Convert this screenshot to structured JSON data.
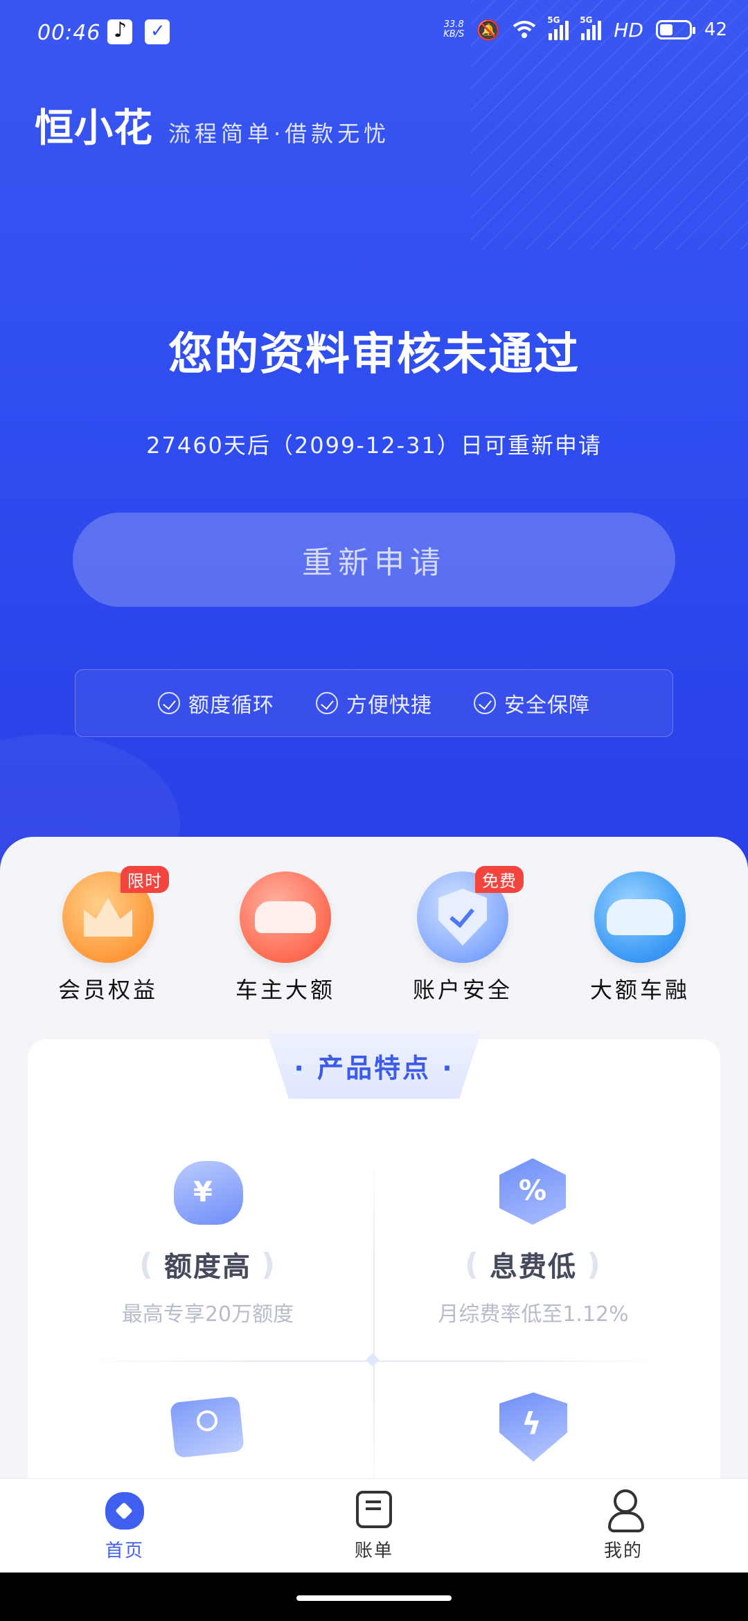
{
  "status_bar": {
    "time": "00:46",
    "net_speed_value": "33.8",
    "net_speed_unit": "KB/S",
    "signal1_label": "5G",
    "signal2_label": "5G",
    "hd_label": "HD",
    "battery": "42"
  },
  "header": {
    "brand": "恒小花",
    "slogan": "流程简单·借款无忧"
  },
  "status": {
    "title": "您的资料审核未通过",
    "subtitle": "27460天后（2099-12-31）日可重新申请",
    "button_label": "重新申请"
  },
  "features": [
    "额度循环",
    "方便快捷",
    "安全保障"
  ],
  "shortcuts": [
    {
      "label": "会员权益",
      "badge": "限时",
      "icon": "crown-icon"
    },
    {
      "label": "车主大额",
      "badge": "",
      "icon": "car-icon"
    },
    {
      "label": "账户安全",
      "badge": "免费",
      "icon": "shield-check-icon"
    },
    {
      "label": "大额车融",
      "badge": "",
      "icon": "car-loan-icon"
    }
  ],
  "product_card": {
    "title": "· 产品特点 ·",
    "items": [
      {
        "title": "额度高",
        "desc": "最高专享20万额度",
        "icon": "money-bag-icon",
        "glyph": "¥"
      },
      {
        "title": "息费低",
        "desc": "月综费率低至1.12%",
        "icon": "percent-icon",
        "glyph": "%"
      },
      {
        "title": "",
        "desc": "",
        "icon": "id-card-icon"
      },
      {
        "title": "",
        "desc": "",
        "icon": "bolt-shield-icon",
        "glyph": "ϟ"
      }
    ]
  },
  "tab_bar": {
    "items": [
      {
        "label": "首页",
        "active": true
      },
      {
        "label": "账单",
        "active": false
      },
      {
        "label": "我的",
        "active": false
      }
    ]
  },
  "colors": {
    "primary": "#2f4ef0",
    "badge": "#f4443e",
    "text_muted": "#b7bccb"
  }
}
